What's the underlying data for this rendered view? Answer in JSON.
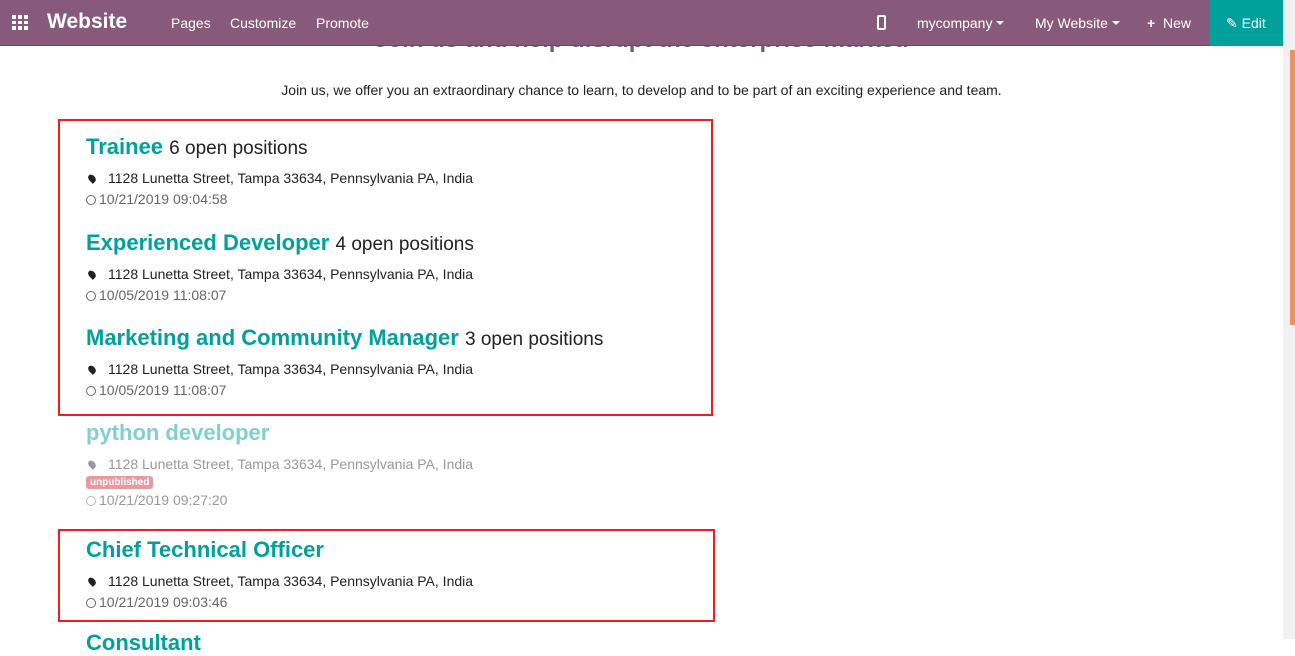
{
  "navbar": {
    "brand": "Website",
    "menu": [
      "Pages",
      "Customize",
      "Promote"
    ],
    "company": "mycompany",
    "website": "My Website",
    "new_label": "New",
    "edit_label": "Edit",
    "colors": {
      "bar": "#875A7B",
      "edit": "#00A09D"
    }
  },
  "page": {
    "heading": "Join us and help disrupt the enterprise market.",
    "intro": "Join us, we offer you an extraordinary chance to learn, to develop and to be part of an exciting experience and team."
  },
  "jobs": [
    {
      "title": "Trainee",
      "count": "6 open positions",
      "address": "1128 Lunetta Street, Tampa 33634, Pennsylvania PA, India",
      "date": "10/21/2019 09:04:58"
    },
    {
      "title": "Experienced Developer",
      "count": "4 open positions",
      "address": "1128 Lunetta Street, Tampa 33634, Pennsylvania PA, India",
      "date": "10/05/2019 11:08:07"
    },
    {
      "title": "Marketing and Community Manager",
      "count": "3 open positions",
      "address": "1128 Lunetta Street, Tampa 33634, Pennsylvania PA, India",
      "date": "10/05/2019 11:08:07"
    },
    {
      "title": "python developer",
      "address": "1128 Lunetta Street, Tampa 33634, Pennsylvania PA, India",
      "badge": "unpublished",
      "date": "10/21/2019 09:27:20"
    },
    {
      "title": "Chief Technical Officer",
      "address": "1128 Lunetta Street, Tampa 33634, Pennsylvania PA, India",
      "date": "10/21/2019 09:03:46"
    },
    {
      "title": "Consultant"
    }
  ]
}
